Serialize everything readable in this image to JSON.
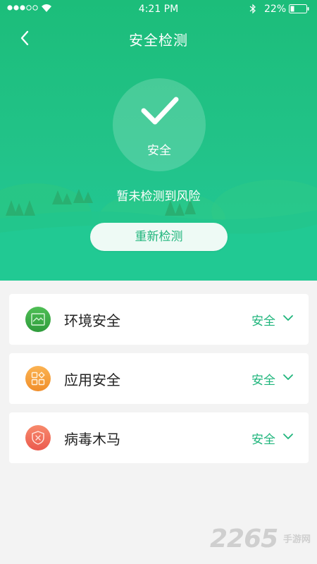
{
  "status_bar": {
    "time": "4:21 PM",
    "battery": "22%"
  },
  "nav": {
    "title": "安全检测",
    "back_icon": "chevron-left-icon"
  },
  "hero": {
    "circle_label": "安全",
    "status_text": "暂未检测到风险",
    "rescan_label": "重新检测",
    "accent_color": "#1fb57c"
  },
  "items": [
    {
      "title": "环境安全",
      "status": "安全",
      "icon": "environment-icon",
      "icon_color": "#3aa845"
    },
    {
      "title": "应用安全",
      "status": "安全",
      "icon": "apps-grid-icon",
      "icon_color": "#f6a03c"
    },
    {
      "title": "病毒木马",
      "status": "安全",
      "icon": "virus-shield-icon",
      "icon_color": "#f06a55"
    }
  ],
  "watermark": {
    "number": "2265",
    "text": "手游网"
  }
}
